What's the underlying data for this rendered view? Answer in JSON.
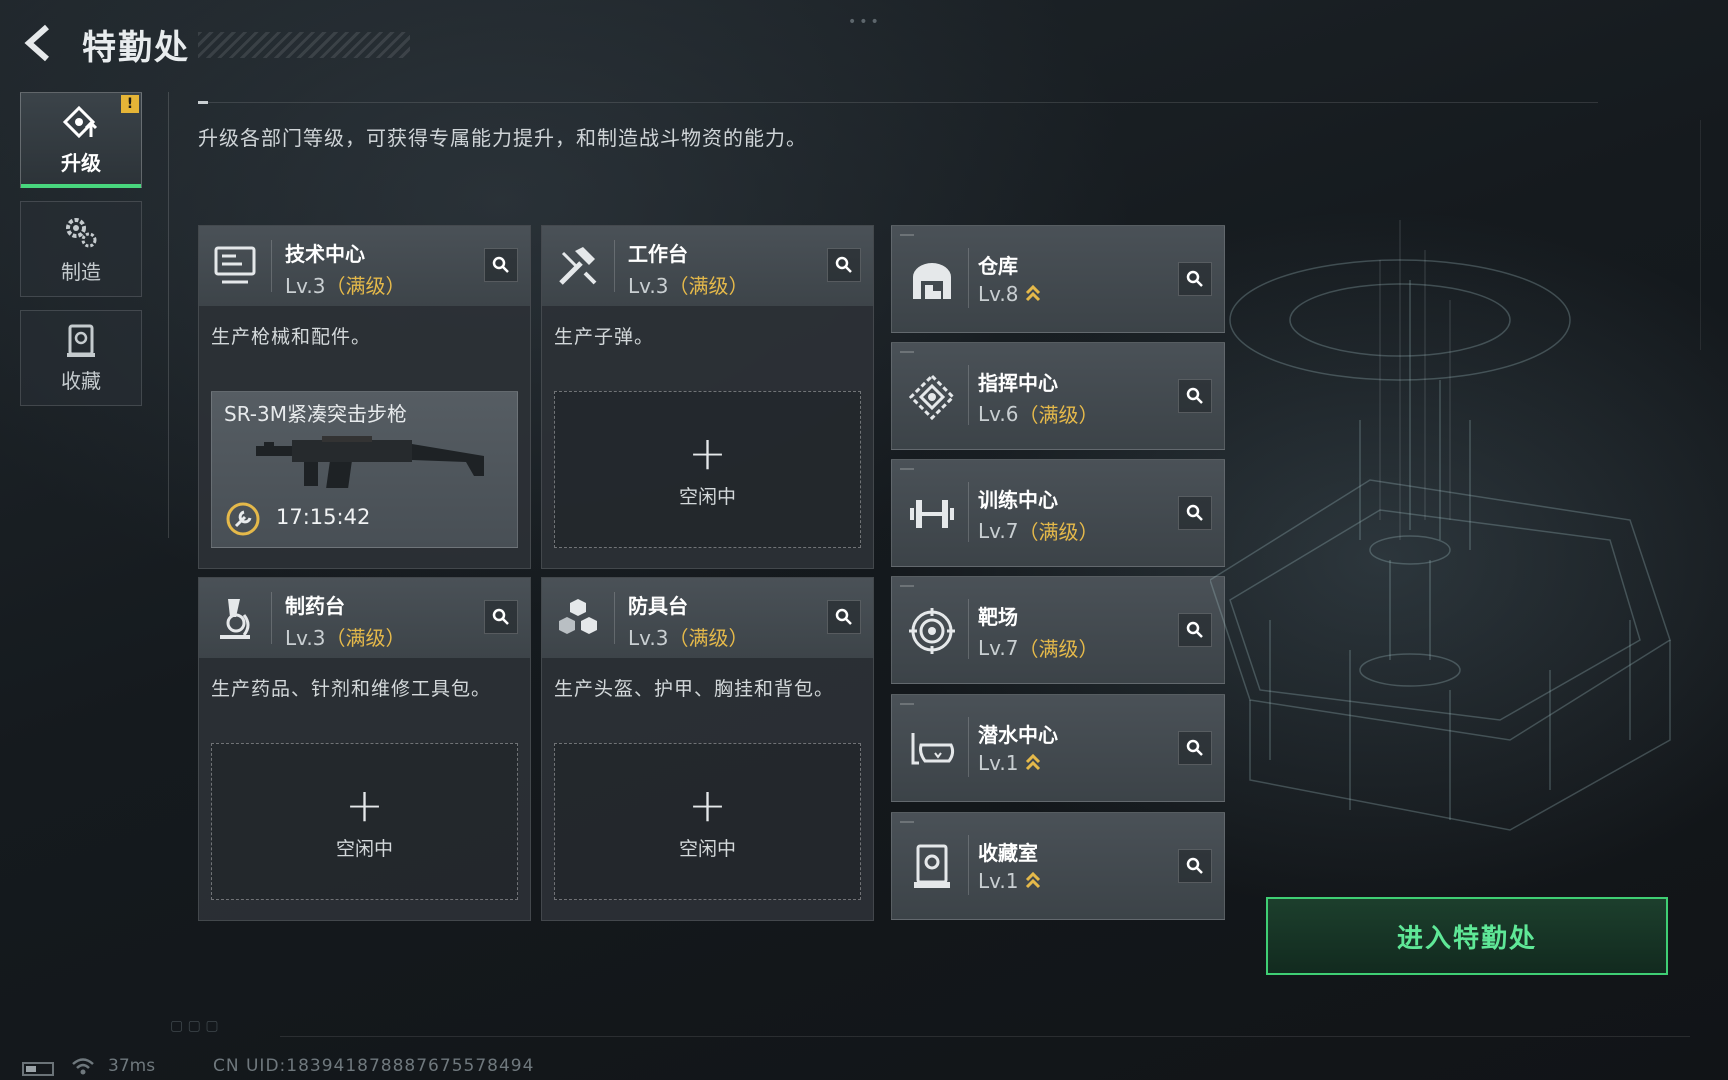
{
  "header": {
    "title": "特勤处"
  },
  "sidebar": {
    "tabs": [
      {
        "label": "升级",
        "icon": "upgrade-icon",
        "active": true,
        "badge": "!"
      },
      {
        "label": "制造",
        "icon": "gears-icon",
        "active": false
      },
      {
        "label": "收藏",
        "icon": "collection-icon",
        "active": false
      }
    ]
  },
  "main": {
    "subtitle": "升级各部门等级，可获得专属能力提升，和制造战斗物资的能力。",
    "cards": [
      {
        "name": "技术中心",
        "level": "Lv.3",
        "max_label": "（满级）",
        "desc": "生产枪械和配件。",
        "icon": "computer-icon",
        "crafting": {
          "item": "SR-3M紧凑突击步枪",
          "timer": "17:15:42"
        }
      },
      {
        "name": "工作台",
        "level": "Lv.3",
        "max_label": "（满级）",
        "desc": "生产子弹。",
        "icon": "hammer-icon",
        "idle_label": "空闲中"
      },
      {
        "name": "制药台",
        "level": "Lv.3",
        "max_label": "（满级）",
        "desc": "生产药品、针剂和维修工具包。",
        "icon": "microscope-icon",
        "idle_label": "空闲中"
      },
      {
        "name": "防具台",
        "level": "Lv.3",
        "max_label": "（满级）",
        "desc": "生产头盔、护甲、胸挂和背包。",
        "icon": "cubes-icon",
        "idle_label": "空闲中"
      }
    ],
    "facilities": [
      {
        "name": "仓库",
        "level": "Lv.8",
        "max_label": "",
        "upgradable": true,
        "icon": "warehouse-icon"
      },
      {
        "name": "指挥中心",
        "level": "Lv.6",
        "max_label": "（满级）",
        "upgradable": false,
        "icon": "command-icon"
      },
      {
        "name": "训练中心",
        "level": "Lv.7",
        "max_label": "（满级）",
        "upgradable": false,
        "icon": "dumbbell-icon"
      },
      {
        "name": "靶场",
        "level": "Lv.7",
        "max_label": "（满级）",
        "upgradable": false,
        "icon": "target-icon"
      },
      {
        "name": "潜水中心",
        "level": "Lv.1",
        "max_label": "",
        "upgradable": true,
        "icon": "diving-mask-icon"
      },
      {
        "name": "收藏室",
        "level": "Lv.1",
        "max_label": "",
        "upgradable": true,
        "icon": "collection-room-icon"
      }
    ],
    "enter_button": "进入特勤处"
  },
  "status_bar": {
    "ping": "37ms",
    "uid": "CN UID:18394187888767557849​4"
  },
  "colors": {
    "accent_green": "#3fcf74",
    "max_gold": "#e5b94a",
    "badge_yellow": "#e6b537"
  }
}
